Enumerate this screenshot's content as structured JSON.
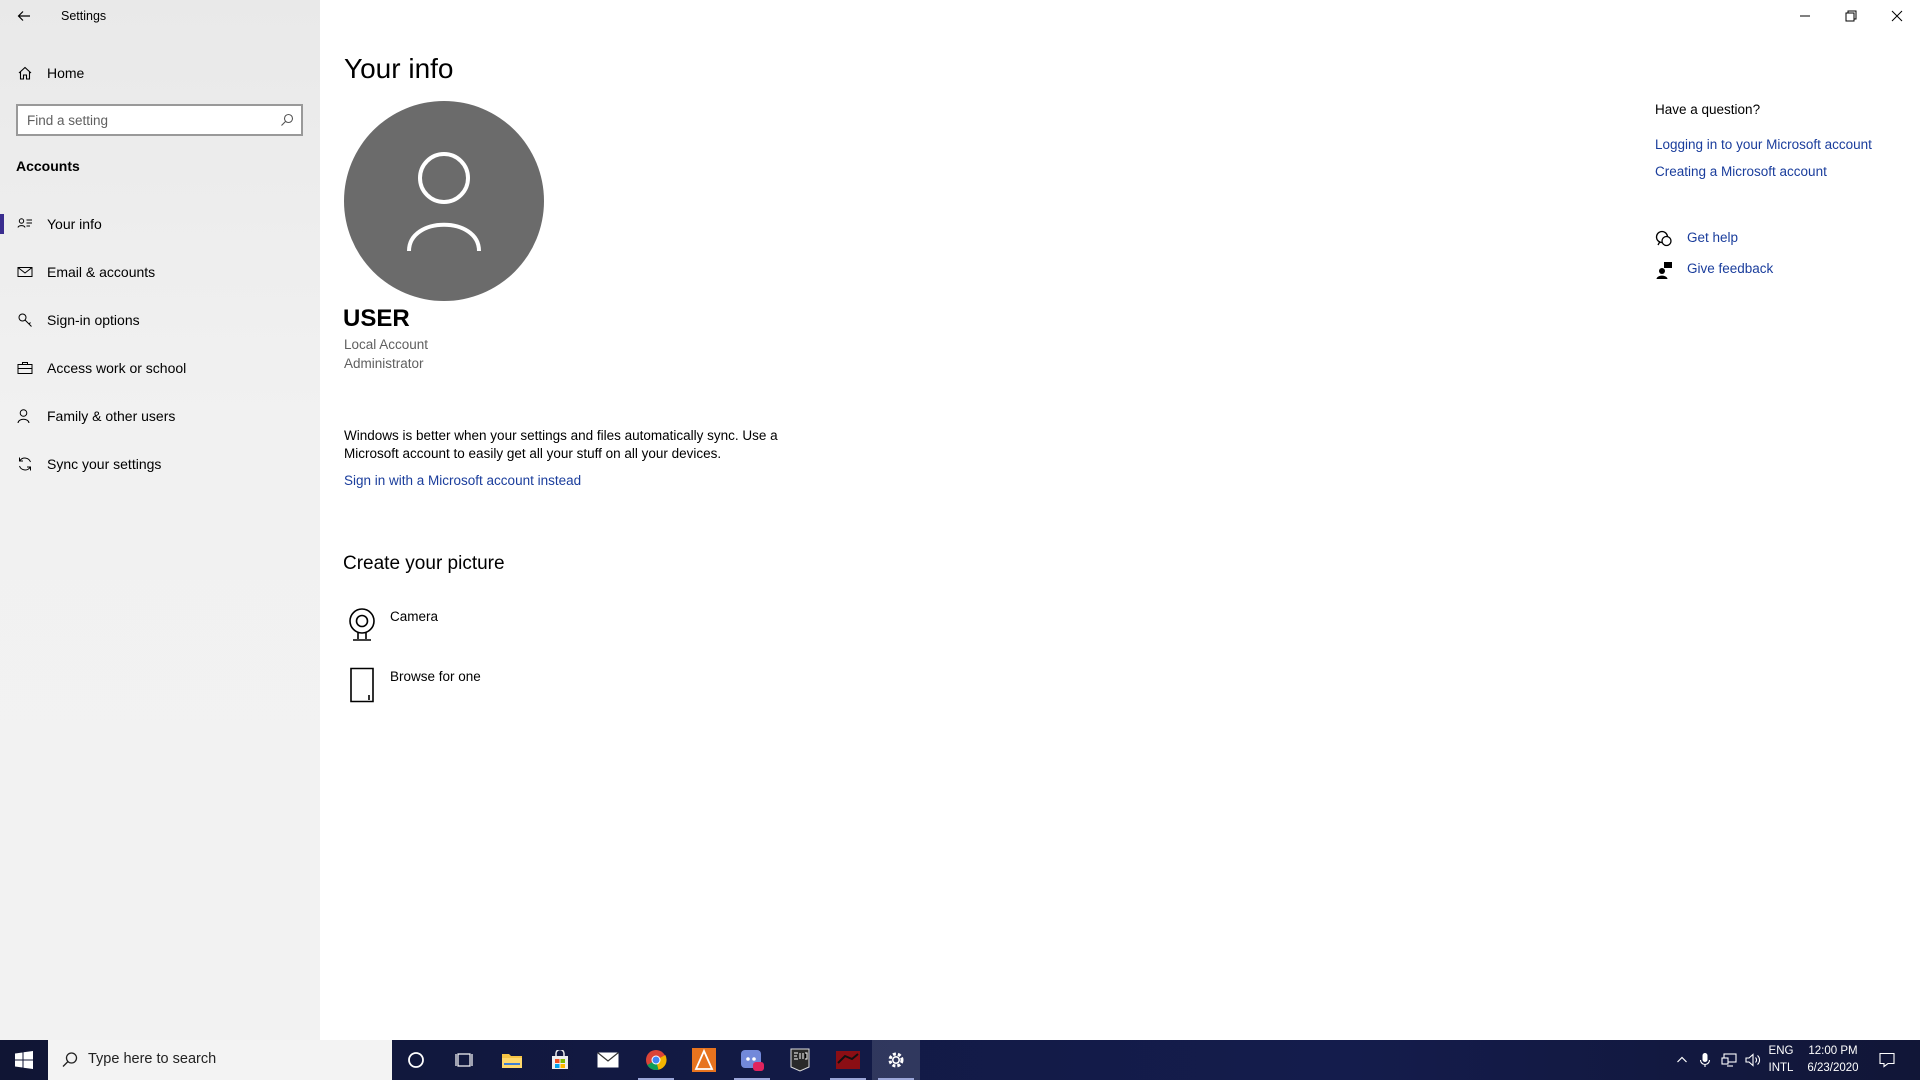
{
  "window": {
    "app_title": "Settings"
  },
  "nav": {
    "home_label": "Home",
    "search_placeholder": "Find a setting",
    "section_title": "Accounts",
    "items": [
      {
        "label": "Your info",
        "icon": "person-card-icon",
        "selected": true
      },
      {
        "label": "Email & accounts",
        "icon": "mail-icon",
        "selected": false
      },
      {
        "label": "Sign-in options",
        "icon": "key-icon",
        "selected": false
      },
      {
        "label": "Access work or school",
        "icon": "briefcase-icon",
        "selected": false
      },
      {
        "label": "Family & other users",
        "icon": "person-add-icon",
        "selected": false
      },
      {
        "label": "Sync your settings",
        "icon": "sync-icon",
        "selected": false
      }
    ]
  },
  "main": {
    "page_title": "Your info",
    "user_name": "USER",
    "account_type": "Local Account",
    "account_role": "Administrator",
    "sync_text": "Windows is better when your settings and files automatically sync. Use a Microsoft account to easily get all your stuff on all your devices.",
    "ms_link": "Sign in with a Microsoft account instead",
    "picture_title": "Create your picture",
    "picture_options": [
      {
        "label": "Camera",
        "icon": "camera-icon"
      },
      {
        "label": "Browse for one",
        "icon": "file-icon"
      }
    ]
  },
  "help": {
    "question": "Have a question?",
    "links": [
      "Logging in to your Microsoft account",
      "Creating a Microsoft account"
    ],
    "get_help": "Get help",
    "give_feedback": "Give feedback"
  },
  "taskbar": {
    "search_text": "Type here to search",
    "apps": [
      "cortana-icon",
      "task-view-icon",
      "file-explorer-icon",
      "store-icon",
      "mail-icon",
      "chrome-icon",
      "vlc-icon",
      "discord-icon",
      "epic-games-icon",
      "red-app-icon",
      "settings-icon"
    ],
    "lang_line1": "ENG",
    "lang_line2": "INTL",
    "time": "12:00 PM",
    "date": "6/23/2020"
  },
  "colors": {
    "accent": "#3a2d8f",
    "link": "#1a3d9c",
    "avatar": "#6b6b6b",
    "taskbar": "#121a45"
  }
}
